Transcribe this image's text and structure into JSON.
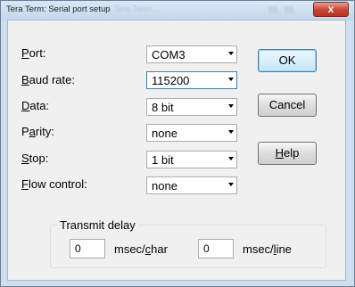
{
  "window": {
    "title": "Tera Term: Serial port setup",
    "title_ghost": "  .     .    Tera Term ...",
    "close_glyph": "x"
  },
  "fields": {
    "port": {
      "label_pre": "",
      "label_key": "P",
      "label_post": "ort:",
      "value": "COM3"
    },
    "baud": {
      "label_pre": "",
      "label_key": "B",
      "label_post": "aud rate:",
      "value": "115200"
    },
    "data": {
      "label_pre": "",
      "label_key": "D",
      "label_post": "ata:",
      "value": "8 bit"
    },
    "parity": {
      "label_pre": "P",
      "label_key": "a",
      "label_post": "rity:",
      "value": "none"
    },
    "stop": {
      "label_pre": "",
      "label_key": "S",
      "label_post": "top:",
      "value": "1 bit"
    },
    "flow": {
      "label_pre": "",
      "label_key": "F",
      "label_post": "low control:",
      "value": "none"
    }
  },
  "buttons": {
    "ok": "OK",
    "cancel": "Cancel",
    "help_key": "H",
    "help_rest": "elp"
  },
  "transmit_delay": {
    "title": "Transmit delay",
    "char_value": "0",
    "char_unit_pre": "msec/",
    "char_unit_key": "c",
    "char_unit_post": "har",
    "line_value": "0",
    "line_unit_pre": "msec/",
    "line_unit_key": "l",
    "line_unit_post": "ine"
  }
}
